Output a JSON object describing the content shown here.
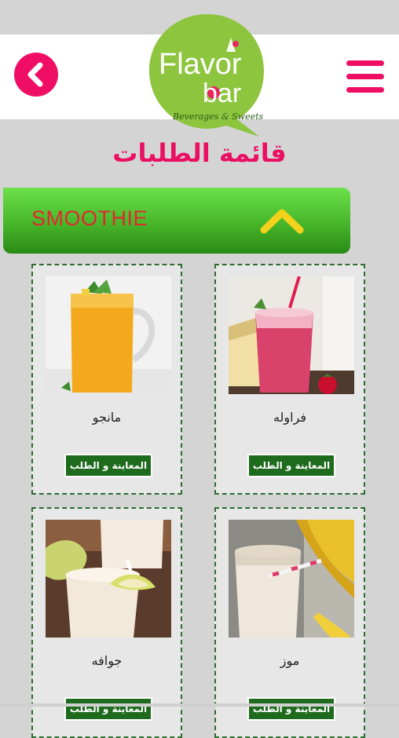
{
  "header": {
    "logo_line1": "Flavor",
    "logo_line2": "bar",
    "logo_tagline": "Beverages & Sweets"
  },
  "page_title": "قائمة الطلبات",
  "category": {
    "label": "SMOOTHIE",
    "expanded": true
  },
  "products": [
    {
      "name": "فراوله",
      "button": "المعاينة و الطلب",
      "photo": "strawberry-smoothie"
    },
    {
      "name": "مانجو",
      "button": "المعاينة و الطلب",
      "photo": "mango-smoothie"
    },
    {
      "name": "موز",
      "button": "المعاينة و الطلب",
      "photo": "banana-smoothie"
    },
    {
      "name": "جوافه",
      "button": "المعاينة و الطلب",
      "photo": "guava-smoothie"
    }
  ],
  "colors": {
    "accent": "#ef0e64",
    "logo_green": "#8dc53e",
    "category_green": "#4aba2c",
    "button_green": "#1e6b1e",
    "category_text": "#e0282e",
    "chevron_yellow": "#f4d21b"
  },
  "icons": {
    "back": "back-arrow-icon",
    "menu": "hamburger-menu-icon",
    "collapse": "chevron-up-icon"
  }
}
